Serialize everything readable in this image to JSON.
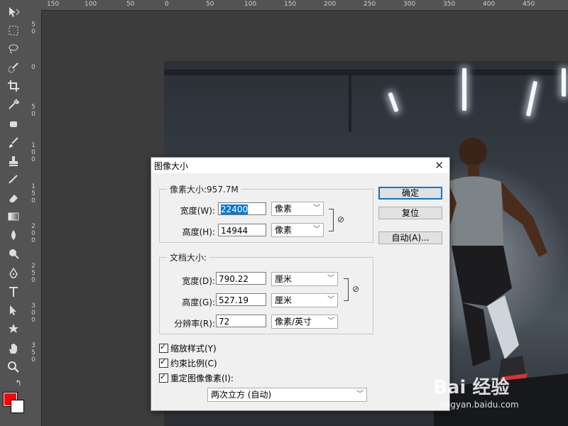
{
  "rulers": {
    "top_ticks": [
      "150",
      "100",
      "50",
      "0",
      "50",
      "100",
      "150",
      "200",
      "250",
      "300",
      "350",
      "400",
      "450"
    ],
    "left_ticks": [
      "5\n0",
      "0",
      "5\n0",
      "1\n0\n0",
      "1\n5\n0",
      "2\n0\n0",
      "2\n5\n0",
      "3\n0\n0",
      "3\n5\n0"
    ]
  },
  "dialog": {
    "title": "图像大小",
    "close_label": "✕",
    "pixel_dims": {
      "legend": "像素大小:957.7M",
      "width_label": "宽度(W):",
      "width_value": "22400",
      "width_unit": "像素",
      "height_label": "高度(H):",
      "height_value": "14944",
      "height_unit": "像素"
    },
    "doc_size": {
      "legend": "文档大小:",
      "width_label": "宽度(D):",
      "width_value": "790.22",
      "width_unit": "厘米",
      "height_label": "高度(G):",
      "height_value": "527.19",
      "height_unit": "厘米",
      "resolution_label": "分辨率(R):",
      "resolution_value": "72",
      "resolution_unit": "像素/英寸"
    },
    "buttons": {
      "ok": "确定",
      "reset": "复位",
      "auto": "自动(A)..."
    },
    "checkboxes": {
      "scale_styles": "缩放样式(Y)",
      "constrain": "约束比例(C)",
      "resample": "重定图像像素(I):"
    },
    "resample_method": "两次立方 (自动)"
  },
  "watermark": {
    "brand": "Bai 经验",
    "url": "jingyan.baidu.com"
  },
  "colors": {
    "foreground": "#ff0000",
    "background": "#ffffff",
    "accent": "#0078d7"
  }
}
